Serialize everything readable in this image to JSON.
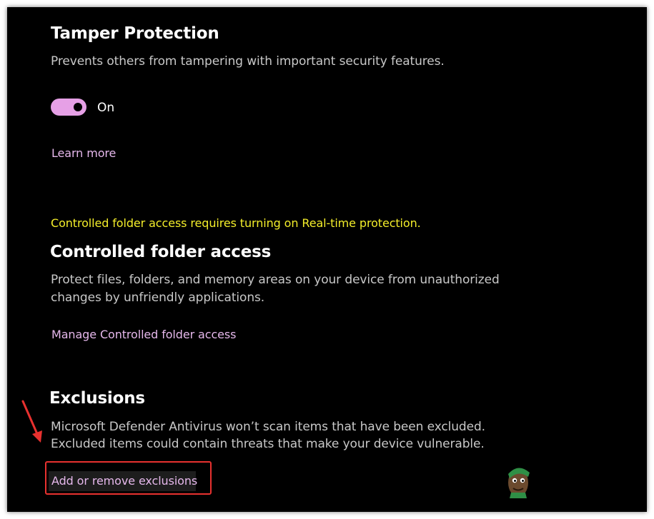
{
  "colors": {
    "background": "#000000",
    "accent": "#e6a0e6",
    "link": "#e6b8ec",
    "warning": "#f4ee2a",
    "annotation": "#e8312f"
  },
  "tamper_protection": {
    "title": "Tamper Protection",
    "description": "Prevents others from tampering with important security features.",
    "toggle_state": "On",
    "toggle_on": true,
    "learn_more": "Learn more"
  },
  "controlled_folder_access": {
    "warning": "Controlled folder access requires turning on Real-time protection.",
    "title": "Controlled folder access",
    "description_line1": "Protect files, folders, and memory areas on your device from unauthorized",
    "description_line2": "changes by unfriendly applications.",
    "manage_link": "Manage Controlled folder access"
  },
  "exclusions": {
    "title": "Exclusions",
    "description_line1": "Microsoft Defender Antivirus won’t scan items that have been excluded.",
    "description_line2": "Excluded items could contain threats that make your device vulnerable.",
    "add_remove_link": "Add or remove exclusions"
  },
  "icons": {
    "annotation_arrow": "red-arrow-icon",
    "watermark": "appuals-logo-icon"
  }
}
